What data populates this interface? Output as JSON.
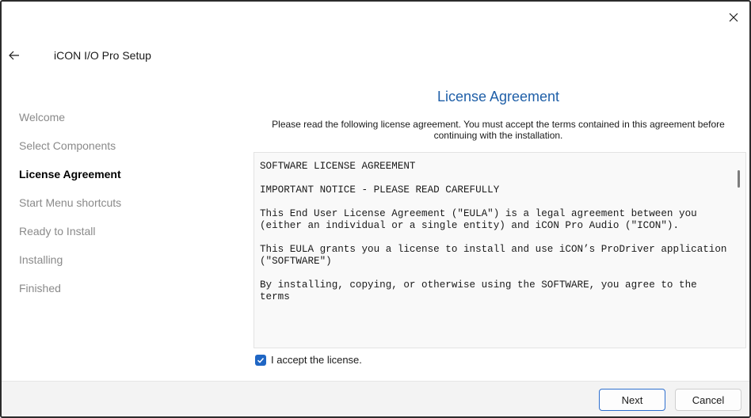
{
  "window": {
    "title": "iCON I/O Pro Setup",
    "close_icon": "close-icon",
    "back_icon": "arrow-left-icon"
  },
  "sidebar": {
    "items": [
      {
        "label": "Welcome",
        "active": false
      },
      {
        "label": "Select Components",
        "active": false
      },
      {
        "label": "License Agreement",
        "active": true
      },
      {
        "label": "Start Menu shortcuts",
        "active": false
      },
      {
        "label": "Ready to Install",
        "active": false
      },
      {
        "label": "Installing",
        "active": false
      },
      {
        "label": "Finished",
        "active": false
      }
    ]
  },
  "main": {
    "heading": "License Agreement",
    "intro": "Please read the following license agreement. You must accept the terms contained in this agreement before continuing with the installation.",
    "license_text": "SOFTWARE LICENSE AGREEMENT\n\nIMPORTANT NOTICE - PLEASE READ CAREFULLY\n\nThis End User License Agreement (\"EULA\") is a legal agreement between you\n(either an individual or a single entity) and iCON Pro Audio (\"ICON\").\n\nThis EULA grants you a license to install and use iCON’s ProDriver application\n(\"SOFTWARE\")\n\nBy installing, copying, or otherwise using the SOFTWARE, you agree to the terms",
    "accept_label": "I accept the license.",
    "accept_checked": true
  },
  "footer": {
    "next_label": "Next",
    "cancel_label": "Cancel"
  },
  "colors": {
    "heading": "#1f5fa8",
    "accent": "#1f66c4",
    "sidebar_inactive": "#8a8a8a"
  }
}
